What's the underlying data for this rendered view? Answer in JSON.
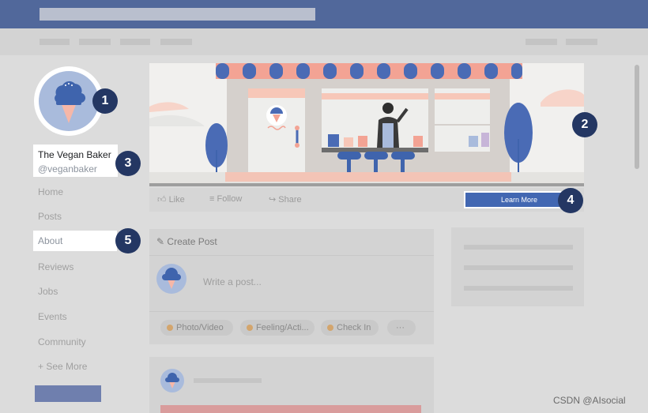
{
  "page": {
    "name": "The Vegan Baker",
    "handle": "@veganbaker"
  },
  "nav": {
    "items": [
      "Home",
      "Posts",
      "About",
      "Reviews",
      "Jobs",
      "Events",
      "Community",
      "+ See More"
    ]
  },
  "badges": [
    "1",
    "2",
    "3",
    "4",
    "5"
  ],
  "actions": {
    "like": "Like",
    "follow": "Follow",
    "share": "Share",
    "learn_more": "Learn More"
  },
  "composer": {
    "title": "Create Post",
    "placeholder": "Write a post...",
    "chips": [
      "Photo/Video",
      "Feeling/Acti...",
      "Check In",
      "···"
    ]
  },
  "watermark": "CSDN @AIsocial",
  "icons": [
    "ice-cream-icon",
    "like-icon",
    "follow-icon",
    "share-icon",
    "pencil-icon"
  ],
  "colors": {
    "brand_blue": "#4267b2",
    "badge": "#243763",
    "topbar": "#51689b"
  }
}
